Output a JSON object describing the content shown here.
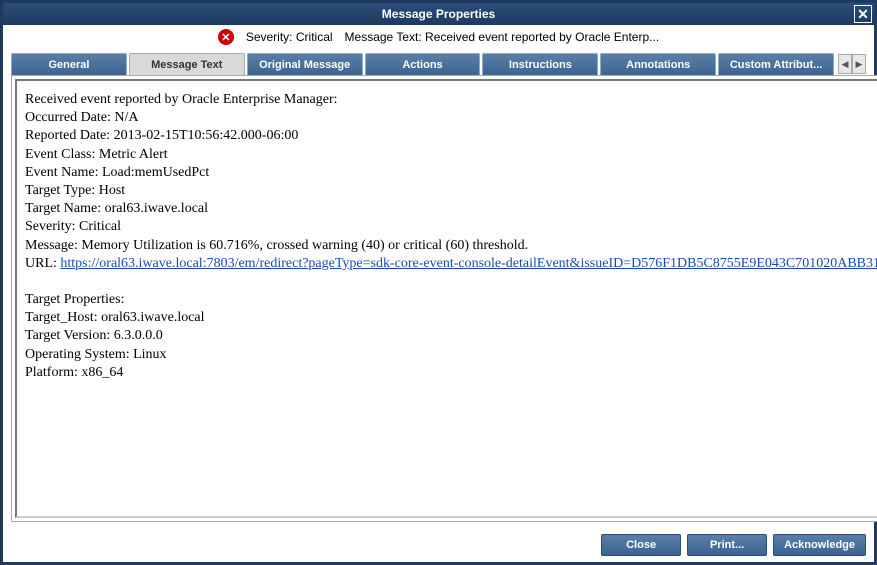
{
  "dialog": {
    "title": "Message Properties"
  },
  "summary": {
    "severity_label": "Severity:",
    "severity_value": "Critical",
    "message_text_label": "Message Text:",
    "message_text_value": "Received event reported by Oracle Enterp..."
  },
  "tabs": {
    "general": "General",
    "message_text": "Message Text",
    "original_message": "Original Message",
    "actions": "Actions",
    "instructions": "Instructions",
    "annotations": "Annotations",
    "custom_attributes": "Custom Attribut..."
  },
  "message": {
    "intro": "Received event reported by Oracle Enterprise Manager:",
    "occurred_date": "Occurred Date: N/A",
    "reported_date": "Reported Date: 2013-02-15T10:56:42.000-06:00",
    "event_class": "Event Class: Metric Alert",
    "event_name": "Event Name: Load:memUsedPct",
    "target_type": "Target Type: Host",
    "target_name": "Target Name: oral63.iwave.local",
    "severity": "Severity: Critical",
    "message": "Message: Memory Utilization is 60.716%, crossed warning (40) or critical (60) threshold.",
    "url_label": "URL: ",
    "url": "https://oral63.iwave.local:7803/em/redirect?pageType=sdk-core-event-console-detailEvent&issueID=D576F1DB5C8755E9E043C701020ABB31",
    "target_properties_header": "Target Properties:",
    "target_host": "Target_Host: oral63.iwave.local",
    "target_version": "Target Version: 6.3.0.0.0",
    "operating_system": "Operating System: Linux",
    "platform": "Platform: x86_64"
  },
  "buttons": {
    "close": "Close",
    "print": "Print...",
    "acknowledge": "Acknowledge"
  }
}
